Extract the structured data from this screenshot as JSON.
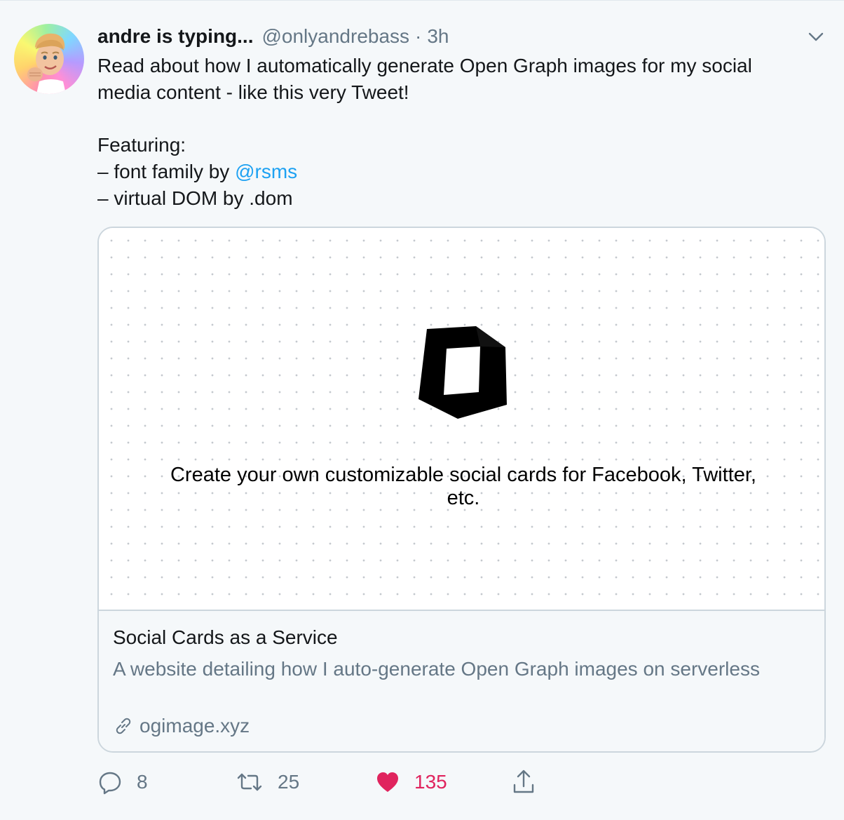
{
  "tweet": {
    "display_name": "andre is typing...",
    "handle": "@onlyandrebass",
    "separator": "·",
    "time": "3h",
    "text": {
      "line1": "Read about how I automatically generate Open Graph images for my social media content - like this very Tweet!",
      "featuring": "Featuring:",
      "item1_prefix": "– font family by ",
      "item1_mention": "@rsms",
      "item2": "– virtual DOM by .dom"
    }
  },
  "card": {
    "image_headline": "Create your own customizable social cards for Facebook, Twitter, etc.",
    "title": "Social Cards as a Service",
    "description": "A website detailing how I auto-generate Open Graph images on serverless",
    "domain": "ogimage.xyz"
  },
  "actions": {
    "replies": "8",
    "retweets": "25",
    "likes": "135"
  },
  "colors": {
    "background": "#f5f8fa",
    "secondary_text": "#657786",
    "link": "#1da1f2",
    "like": "#e0245e",
    "border": "#ccd6dd"
  },
  "icons": [
    "avatar-memoji",
    "chevron-down-icon",
    "link-icon",
    "reply-icon",
    "retweet-icon",
    "heart-icon",
    "share-icon"
  ]
}
